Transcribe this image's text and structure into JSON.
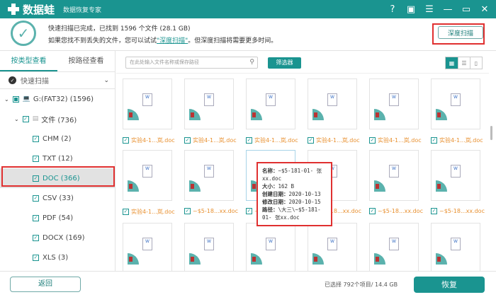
{
  "app": {
    "name": "数据蛙",
    "subtitle": "数据恢复专家"
  },
  "window_icons": [
    "help-icon",
    "save-icon",
    "menu-icon",
    "minimize-icon",
    "maximize-icon",
    "close-icon"
  ],
  "info": {
    "line1": "快速扫描已完成，已找到 1596 个文件 (28.1 GB)",
    "line2_prefix": "如果您找不到丢失的文件，您可以试试",
    "line2_link": "\"深度扫描\"",
    "line2_suffix": "。但深度扫描将需要更多时间。",
    "deep_scan_button": "深度扫描"
  },
  "left": {
    "tabs": [
      "按类型查看",
      "按路径查看"
    ],
    "quick_scan": "快速扫描",
    "drive": "G:(FAT32) (1596)",
    "folder": "文件 (736)",
    "types": [
      {
        "label": "CHM (2)"
      },
      {
        "label": "TXT (12)"
      },
      {
        "label": "DOC (366)",
        "selected": true
      },
      {
        "label": "CSV (33)"
      },
      {
        "label": "PDF (54)"
      },
      {
        "label": "DOCX (169)"
      },
      {
        "label": "XLS (3)"
      }
    ]
  },
  "toolbar": {
    "search_placeholder": "在此处输入文件名称或保存路径",
    "filter": "筛选器"
  },
  "files": {
    "row1": [
      "实验4-1...岚.doc",
      "实验4-1...岚.doc",
      "实验4-1...岚.doc",
      "实验4-1...岚.doc",
      "实验4-1...岚.doc",
      "实验4-1...岚.doc"
    ],
    "row2": [
      "实验4-1...岚.doc",
      "~$5-18...xx.doc",
      "~$5-18...xx.doc",
      "~$5-18...xx.doc",
      "~$5-18...xx.doc",
      "~$5-18...xx.doc"
    ]
  },
  "tooltip": {
    "name_label": "名称：",
    "name": "~$5-181-01- 张xx.doc",
    "size_label": "大小：",
    "size": "162 B",
    "created_label": "创建日期：",
    "created": "2020-10-13",
    "modified_label": "修改日期：",
    "modified": "2020-10-15",
    "path_label": "路径：",
    "path": "\\大三\\~$5-181-01- 张xx.doc"
  },
  "bottom": {
    "back": "返回",
    "status": "已选择 792个项目/ 14.4 GB",
    "restore": "恢复"
  }
}
